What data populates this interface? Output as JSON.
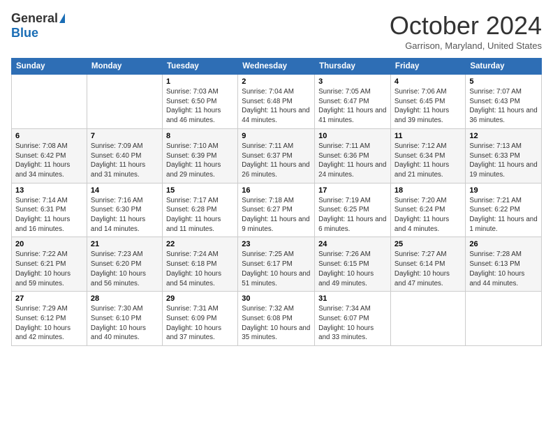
{
  "logo": {
    "general": "General",
    "blue": "Blue"
  },
  "title": "October 2024",
  "location": "Garrison, Maryland, United States",
  "days_of_week": [
    "Sunday",
    "Monday",
    "Tuesday",
    "Wednesday",
    "Thursday",
    "Friday",
    "Saturday"
  ],
  "weeks": [
    [
      {
        "day": "",
        "info": ""
      },
      {
        "day": "",
        "info": ""
      },
      {
        "day": "1",
        "info": "Sunrise: 7:03 AM\nSunset: 6:50 PM\nDaylight: 11 hours and 46 minutes."
      },
      {
        "day": "2",
        "info": "Sunrise: 7:04 AM\nSunset: 6:48 PM\nDaylight: 11 hours and 44 minutes."
      },
      {
        "day": "3",
        "info": "Sunrise: 7:05 AM\nSunset: 6:47 PM\nDaylight: 11 hours and 41 minutes."
      },
      {
        "day": "4",
        "info": "Sunrise: 7:06 AM\nSunset: 6:45 PM\nDaylight: 11 hours and 39 minutes."
      },
      {
        "day": "5",
        "info": "Sunrise: 7:07 AM\nSunset: 6:43 PM\nDaylight: 11 hours and 36 minutes."
      }
    ],
    [
      {
        "day": "6",
        "info": "Sunrise: 7:08 AM\nSunset: 6:42 PM\nDaylight: 11 hours and 34 minutes."
      },
      {
        "day": "7",
        "info": "Sunrise: 7:09 AM\nSunset: 6:40 PM\nDaylight: 11 hours and 31 minutes."
      },
      {
        "day": "8",
        "info": "Sunrise: 7:10 AM\nSunset: 6:39 PM\nDaylight: 11 hours and 29 minutes."
      },
      {
        "day": "9",
        "info": "Sunrise: 7:11 AM\nSunset: 6:37 PM\nDaylight: 11 hours and 26 minutes."
      },
      {
        "day": "10",
        "info": "Sunrise: 7:11 AM\nSunset: 6:36 PM\nDaylight: 11 hours and 24 minutes."
      },
      {
        "day": "11",
        "info": "Sunrise: 7:12 AM\nSunset: 6:34 PM\nDaylight: 11 hours and 21 minutes."
      },
      {
        "day": "12",
        "info": "Sunrise: 7:13 AM\nSunset: 6:33 PM\nDaylight: 11 hours and 19 minutes."
      }
    ],
    [
      {
        "day": "13",
        "info": "Sunrise: 7:14 AM\nSunset: 6:31 PM\nDaylight: 11 hours and 16 minutes."
      },
      {
        "day": "14",
        "info": "Sunrise: 7:16 AM\nSunset: 6:30 PM\nDaylight: 11 hours and 14 minutes."
      },
      {
        "day": "15",
        "info": "Sunrise: 7:17 AM\nSunset: 6:28 PM\nDaylight: 11 hours and 11 minutes."
      },
      {
        "day": "16",
        "info": "Sunrise: 7:18 AM\nSunset: 6:27 PM\nDaylight: 11 hours and 9 minutes."
      },
      {
        "day": "17",
        "info": "Sunrise: 7:19 AM\nSunset: 6:25 PM\nDaylight: 11 hours and 6 minutes."
      },
      {
        "day": "18",
        "info": "Sunrise: 7:20 AM\nSunset: 6:24 PM\nDaylight: 11 hours and 4 minutes."
      },
      {
        "day": "19",
        "info": "Sunrise: 7:21 AM\nSunset: 6:22 PM\nDaylight: 11 hours and 1 minute."
      }
    ],
    [
      {
        "day": "20",
        "info": "Sunrise: 7:22 AM\nSunset: 6:21 PM\nDaylight: 10 hours and 59 minutes."
      },
      {
        "day": "21",
        "info": "Sunrise: 7:23 AM\nSunset: 6:20 PM\nDaylight: 10 hours and 56 minutes."
      },
      {
        "day": "22",
        "info": "Sunrise: 7:24 AM\nSunset: 6:18 PM\nDaylight: 10 hours and 54 minutes."
      },
      {
        "day": "23",
        "info": "Sunrise: 7:25 AM\nSunset: 6:17 PM\nDaylight: 10 hours and 51 minutes."
      },
      {
        "day": "24",
        "info": "Sunrise: 7:26 AM\nSunset: 6:15 PM\nDaylight: 10 hours and 49 minutes."
      },
      {
        "day": "25",
        "info": "Sunrise: 7:27 AM\nSunset: 6:14 PM\nDaylight: 10 hours and 47 minutes."
      },
      {
        "day": "26",
        "info": "Sunrise: 7:28 AM\nSunset: 6:13 PM\nDaylight: 10 hours and 44 minutes."
      }
    ],
    [
      {
        "day": "27",
        "info": "Sunrise: 7:29 AM\nSunset: 6:12 PM\nDaylight: 10 hours and 42 minutes."
      },
      {
        "day": "28",
        "info": "Sunrise: 7:30 AM\nSunset: 6:10 PM\nDaylight: 10 hours and 40 minutes."
      },
      {
        "day": "29",
        "info": "Sunrise: 7:31 AM\nSunset: 6:09 PM\nDaylight: 10 hours and 37 minutes."
      },
      {
        "day": "30",
        "info": "Sunrise: 7:32 AM\nSunset: 6:08 PM\nDaylight: 10 hours and 35 minutes."
      },
      {
        "day": "31",
        "info": "Sunrise: 7:34 AM\nSunset: 6:07 PM\nDaylight: 10 hours and 33 minutes."
      },
      {
        "day": "",
        "info": ""
      },
      {
        "day": "",
        "info": ""
      }
    ]
  ]
}
